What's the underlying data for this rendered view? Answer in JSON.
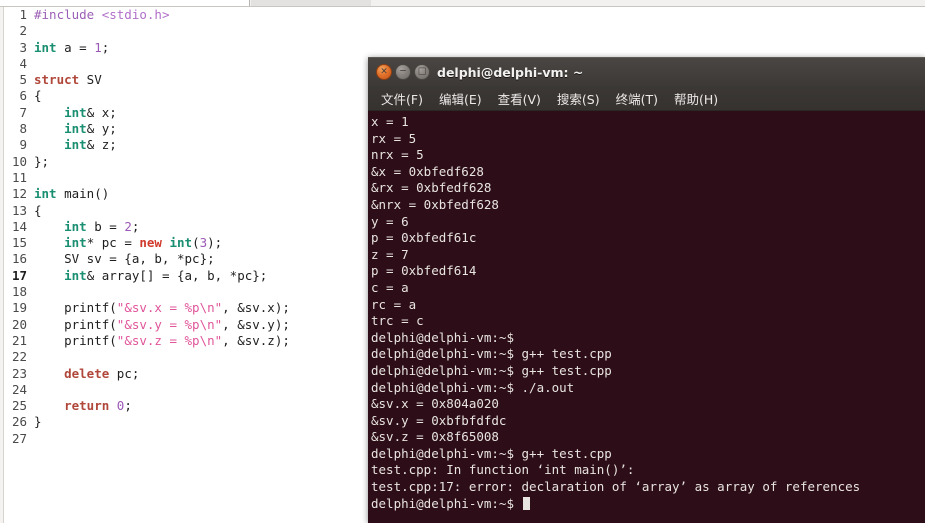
{
  "editor": {
    "name": "source-code-editor",
    "lines": [
      {
        "n": "1",
        "tokens": [
          {
            "t": "pre",
            "v": "#include "
          },
          {
            "t": "hdr",
            "v": "<stdio.h>"
          }
        ]
      },
      {
        "n": "2",
        "tokens": []
      },
      {
        "n": "3",
        "tokens": [
          {
            "t": "type",
            "v": "int"
          },
          {
            "t": "plain",
            "v": " a = "
          },
          {
            "t": "num",
            "v": "1"
          },
          {
            "t": "plain",
            "v": ";"
          }
        ]
      },
      {
        "n": "4",
        "tokens": []
      },
      {
        "n": "5",
        "tokens": [
          {
            "t": "kw",
            "v": "struct"
          },
          {
            "t": "plain",
            "v": " SV"
          }
        ]
      },
      {
        "n": "6",
        "tokens": [
          {
            "t": "plain",
            "v": "{"
          }
        ]
      },
      {
        "n": "7",
        "tokens": [
          {
            "t": "plain",
            "v": "    "
          },
          {
            "t": "type",
            "v": "int"
          },
          {
            "t": "plain",
            "v": "& x;"
          }
        ]
      },
      {
        "n": "8",
        "tokens": [
          {
            "t": "plain",
            "v": "    "
          },
          {
            "t": "type",
            "v": "int"
          },
          {
            "t": "plain",
            "v": "& y;"
          }
        ]
      },
      {
        "n": "9",
        "tokens": [
          {
            "t": "plain",
            "v": "    "
          },
          {
            "t": "type",
            "v": "int"
          },
          {
            "t": "plain",
            "v": "& z;"
          }
        ]
      },
      {
        "n": "10",
        "tokens": [
          {
            "t": "plain",
            "v": "};"
          }
        ]
      },
      {
        "n": "11",
        "tokens": []
      },
      {
        "n": "12",
        "tokens": [
          {
            "t": "type",
            "v": "int"
          },
          {
            "t": "plain",
            "v": " main()"
          }
        ]
      },
      {
        "n": "13",
        "tokens": [
          {
            "t": "plain",
            "v": "{"
          }
        ]
      },
      {
        "n": "14",
        "tokens": [
          {
            "t": "plain",
            "v": "    "
          },
          {
            "t": "type",
            "v": "int"
          },
          {
            "t": "plain",
            "v": " b = "
          },
          {
            "t": "num",
            "v": "2"
          },
          {
            "t": "plain",
            "v": ";"
          }
        ]
      },
      {
        "n": "15",
        "tokens": [
          {
            "t": "plain",
            "v": "    "
          },
          {
            "t": "type",
            "v": "int"
          },
          {
            "t": "plain",
            "v": "* pc = "
          },
          {
            "t": "new",
            "v": "new"
          },
          {
            "t": "plain",
            "v": " "
          },
          {
            "t": "type",
            "v": "int"
          },
          {
            "t": "plain",
            "v": "("
          },
          {
            "t": "num",
            "v": "3"
          },
          {
            "t": "plain",
            "v": ");"
          }
        ]
      },
      {
        "n": "16",
        "tokens": [
          {
            "t": "plain",
            "v": "    SV sv = {a, b, *pc};"
          }
        ]
      },
      {
        "n": "17",
        "err": true,
        "tokens": [
          {
            "t": "plain",
            "v": "    "
          },
          {
            "t": "type",
            "v": "int"
          },
          {
            "t": "plain",
            "v": "& array[] = {a, b, *pc};"
          }
        ]
      },
      {
        "n": "18",
        "tokens": []
      },
      {
        "n": "19",
        "tokens": [
          {
            "t": "plain",
            "v": "    printf("
          },
          {
            "t": "str",
            "v": "\"&sv.x = %p\\n\""
          },
          {
            "t": "plain",
            "v": ", &sv.x);"
          }
        ]
      },
      {
        "n": "20",
        "tokens": [
          {
            "t": "plain",
            "v": "    printf("
          },
          {
            "t": "str",
            "v": "\"&sv.y = %p\\n\""
          },
          {
            "t": "plain",
            "v": ", &sv.y);"
          }
        ]
      },
      {
        "n": "21",
        "tokens": [
          {
            "t": "plain",
            "v": "    printf("
          },
          {
            "t": "str",
            "v": "\"&sv.z = %p\\n\""
          },
          {
            "t": "plain",
            "v": ", &sv.z);"
          }
        ]
      },
      {
        "n": "22",
        "tokens": []
      },
      {
        "n": "23",
        "tokens": [
          {
            "t": "plain",
            "v": "    "
          },
          {
            "t": "kw",
            "v": "delete"
          },
          {
            "t": "plain",
            "v": " pc;"
          }
        ]
      },
      {
        "n": "24",
        "tokens": []
      },
      {
        "n": "25",
        "tokens": [
          {
            "t": "plain",
            "v": "    "
          },
          {
            "t": "kw",
            "v": "return"
          },
          {
            "t": "plain",
            "v": " "
          },
          {
            "t": "num",
            "v": "0"
          },
          {
            "t": "plain",
            "v": ";"
          }
        ]
      },
      {
        "n": "26",
        "tokens": [
          {
            "t": "plain",
            "v": "}"
          }
        ]
      },
      {
        "n": "27",
        "tokens": []
      }
    ]
  },
  "terminal": {
    "title": "delphi@delphi-vm: ~",
    "window_buttons": [
      {
        "name": "close-button",
        "glyph": "×"
      },
      {
        "name": "minimize-button",
        "glyph": "−"
      },
      {
        "name": "maximize-button",
        "glyph": "□"
      }
    ],
    "menu": [
      {
        "label": "文件(F)",
        "name": "menu-file"
      },
      {
        "label": "编辑(E)",
        "name": "menu-edit"
      },
      {
        "label": "查看(V)",
        "name": "menu-view"
      },
      {
        "label": "搜索(S)",
        "name": "menu-search"
      },
      {
        "label": "终端(T)",
        "name": "menu-terminal"
      },
      {
        "label": "帮助(H)",
        "name": "menu-help"
      }
    ],
    "output": [
      "x = 1",
      "rx = 5",
      "nrx = 5",
      "&x = 0xbfedf628",
      "&rx = 0xbfedf628",
      "&nrx = 0xbfedf628",
      "y = 6",
      "p = 0xbfedf61c",
      "z = 7",
      "p = 0xbfedf614",
      "c = a",
      "rc = a",
      "trc = c",
      "delphi@delphi-vm:~$",
      "delphi@delphi-vm:~$ g++ test.cpp",
      "delphi@delphi-vm:~$ g++ test.cpp",
      "delphi@delphi-vm:~$ ./a.out",
      "&sv.x = 0x804a020",
      "&sv.y = 0xbfbfdfdc",
      "&sv.z = 0x8f65008",
      "delphi@delphi-vm:~$ g++ test.cpp",
      "test.cpp: In function ‘int main()’:",
      "test.cpp:17: error: declaration of ‘array’ as array of references"
    ],
    "prompt_last": "delphi@delphi-vm:~$ ",
    "colors": {
      "terminal_bg": "#2d0d18",
      "terminal_fg": "#e8e4e0",
      "titlebar_bg": "#3c3936",
      "close_button": "#e2702a"
    }
  }
}
